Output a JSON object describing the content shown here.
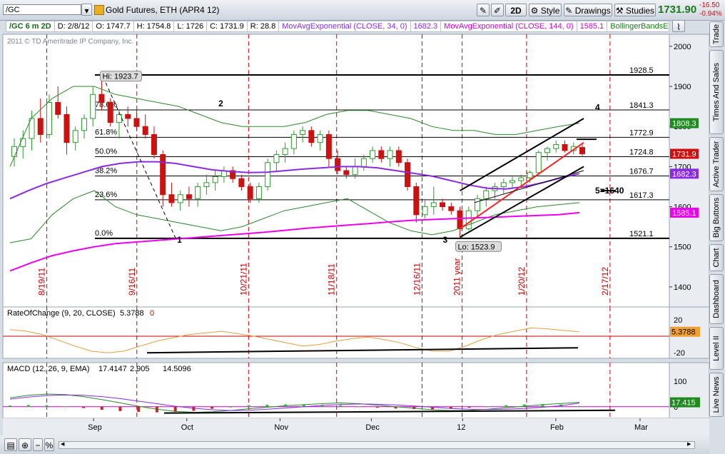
{
  "toolbar": {
    "symbol": "/GC",
    "instrument_name": "Gold Futures, ETH (APR4 12)",
    "period_button": "2D",
    "style_label": "Style",
    "drawings_label": "Drawings",
    "studies_label": "Studies",
    "last_price": "1731.90",
    "net_change": "-16.50",
    "pct_change": "-0.94%"
  },
  "infobar": {
    "symbol_period": "/GC 6 m 2D",
    "date": "D: 2/8/12",
    "open": "O: 1747.7",
    "high": "H: 1754.8",
    "low": "L: 1726",
    "close": "C: 1731.9",
    "range": "R: 28.8",
    "study1": "MovAvgExponential (CLOSE, 34, 0)",
    "study1_value": "1682.3",
    "study2": "MovAvgExponential (CLOSE, 144, 0)",
    "study2_value": "1585.1",
    "study3": "BollingerBandsEMA (..."
  },
  "copyright": "2011 © TD Ameritrade IP Company, Inc.",
  "side_tabs": [
    "Trade",
    "Times And Sales",
    "Active Trader",
    "Big Buttons",
    "Chart",
    "Dashboard",
    "Level II",
    "Live News"
  ],
  "colors": {
    "up_candle": "#2e9b2e",
    "down_candle": "#cc1111",
    "ema34": "#8a2be2",
    "ema144": "#ee00ee",
    "bollinger": "#2a8a2a",
    "vertical_markers": "#cc0000",
    "fib_lines": "#000000",
    "roc_line": "#e0a040",
    "macd_line": "#2a8a2a",
    "macd_signal": "#8a2be2"
  },
  "chart_data": [
    {
      "type": "candlestick",
      "title": "/GC 6 m 2D",
      "ylim": [
        1350,
        2030
      ],
      "yticks": [
        1400,
        1500,
        1600,
        1700,
        1800,
        1900,
        2000
      ],
      "xlabels": [
        "Sep",
        "Oct",
        "Nov",
        "Dec",
        "12",
        "Feb",
        "Mar"
      ],
      "candles": [
        {
          "o": 1725,
          "h": 1770,
          "l": 1700,
          "c": 1750
        },
        {
          "o": 1750,
          "h": 1790,
          "l": 1720,
          "c": 1770
        },
        {
          "o": 1770,
          "h": 1840,
          "l": 1740,
          "c": 1820
        },
        {
          "o": 1820,
          "h": 1870,
          "l": 1760,
          "c": 1780
        },
        {
          "o": 1780,
          "h": 1880,
          "l": 1770,
          "c": 1860
        },
        {
          "o": 1860,
          "h": 1900,
          "l": 1820,
          "c": 1830
        },
        {
          "o": 1830,
          "h": 1850,
          "l": 1730,
          "c": 1760
        },
        {
          "o": 1760,
          "h": 1800,
          "l": 1740,
          "c": 1790
        },
        {
          "o": 1790,
          "h": 1830,
          "l": 1770,
          "c": 1820
        },
        {
          "o": 1820,
          "h": 1900,
          "l": 1800,
          "c": 1880
        },
        {
          "o": 1880,
          "h": 1923.7,
          "l": 1840,
          "c": 1860
        },
        {
          "o": 1860,
          "h": 1870,
          "l": 1800,
          "c": 1810
        },
        {
          "o": 1810,
          "h": 1840,
          "l": 1770,
          "c": 1830
        },
        {
          "o": 1830,
          "h": 1850,
          "l": 1800,
          "c": 1820
        },
        {
          "o": 1820,
          "h": 1840,
          "l": 1790,
          "c": 1800
        },
        {
          "o": 1800,
          "h": 1830,
          "l": 1770,
          "c": 1780
        },
        {
          "o": 1780,
          "h": 1800,
          "l": 1720,
          "c": 1730
        },
        {
          "o": 1730,
          "h": 1740,
          "l": 1600,
          "c": 1630
        },
        {
          "o": 1630,
          "h": 1660,
          "l": 1600,
          "c": 1610
        },
        {
          "o": 1610,
          "h": 1640,
          "l": 1590,
          "c": 1630
        },
        {
          "o": 1630,
          "h": 1650,
          "l": 1600,
          "c": 1620
        },
        {
          "o": 1620,
          "h": 1660,
          "l": 1600,
          "c": 1650
        },
        {
          "o": 1650,
          "h": 1680,
          "l": 1630,
          "c": 1660
        },
        {
          "o": 1660,
          "h": 1690,
          "l": 1640,
          "c": 1675
        },
        {
          "o": 1675,
          "h": 1700,
          "l": 1660,
          "c": 1690
        },
        {
          "o": 1690,
          "h": 1700,
          "l": 1660,
          "c": 1670
        },
        {
          "o": 1670,
          "h": 1680,
          "l": 1640,
          "c": 1650
        },
        {
          "o": 1650,
          "h": 1660,
          "l": 1610,
          "c": 1620
        },
        {
          "o": 1620,
          "h": 1660,
          "l": 1610,
          "c": 1650
        },
        {
          "o": 1650,
          "h": 1720,
          "l": 1640,
          "c": 1710
        },
        {
          "o": 1710,
          "h": 1740,
          "l": 1690,
          "c": 1730
        },
        {
          "o": 1730,
          "h": 1760,
          "l": 1710,
          "c": 1745
        },
        {
          "o": 1745,
          "h": 1790,
          "l": 1730,
          "c": 1780
        },
        {
          "o": 1780,
          "h": 1800,
          "l": 1760,
          "c": 1790
        },
        {
          "o": 1790,
          "h": 1800,
          "l": 1750,
          "c": 1760
        },
        {
          "o": 1760,
          "h": 1790,
          "l": 1740,
          "c": 1780
        },
        {
          "o": 1780,
          "h": 1790,
          "l": 1700,
          "c": 1720
        },
        {
          "o": 1720,
          "h": 1740,
          "l": 1680,
          "c": 1690
        },
        {
          "o": 1690,
          "h": 1700,
          "l": 1670,
          "c": 1680
        },
        {
          "o": 1680,
          "h": 1720,
          "l": 1670,
          "c": 1700
        },
        {
          "o": 1700,
          "h": 1730,
          "l": 1690,
          "c": 1720
        },
        {
          "o": 1720,
          "h": 1750,
          "l": 1710,
          "c": 1740
        },
        {
          "o": 1740,
          "h": 1750,
          "l": 1710,
          "c": 1720
        },
        {
          "o": 1720,
          "h": 1750,
          "l": 1700,
          "c": 1740
        },
        {
          "o": 1740,
          "h": 1750,
          "l": 1700,
          "c": 1710
        },
        {
          "o": 1710,
          "h": 1720,
          "l": 1640,
          "c": 1650
        },
        {
          "o": 1650,
          "h": 1660,
          "l": 1560,
          "c": 1580
        },
        {
          "o": 1580,
          "h": 1620,
          "l": 1570,
          "c": 1600
        },
        {
          "o": 1600,
          "h": 1650,
          "l": 1580,
          "c": 1610
        },
        {
          "o": 1610,
          "h": 1620,
          "l": 1590,
          "c": 1600
        },
        {
          "o": 1600,
          "h": 1610,
          "l": 1580,
          "c": 1590
        },
        {
          "o": 1590,
          "h": 1600,
          "l": 1523.9,
          "c": 1545
        },
        {
          "o": 1545,
          "h": 1600,
          "l": 1540,
          "c": 1590
        },
        {
          "o": 1590,
          "h": 1630,
          "l": 1570,
          "c": 1620
        },
        {
          "o": 1620,
          "h": 1650,
          "l": 1600,
          "c": 1640
        },
        {
          "o": 1640,
          "h": 1660,
          "l": 1620,
          "c": 1650
        },
        {
          "o": 1650,
          "h": 1670,
          "l": 1630,
          "c": 1660
        },
        {
          "o": 1660,
          "h": 1675,
          "l": 1645,
          "c": 1665
        },
        {
          "o": 1665,
          "h": 1680,
          "l": 1650,
          "c": 1672
        },
        {
          "o": 1672,
          "h": 1690,
          "l": 1660,
          "c": 1685
        },
        {
          "o": 1685,
          "h": 1740,
          "l": 1680,
          "c": 1735
        },
        {
          "o": 1735,
          "h": 1750,
          "l": 1715,
          "c": 1745
        },
        {
          "o": 1745,
          "h": 1765,
          "l": 1735,
          "c": 1755
        },
        {
          "o": 1755,
          "h": 1765,
          "l": 1735,
          "c": 1740
        },
        {
          "o": 1740,
          "h": 1760,
          "l": 1730,
          "c": 1750
        },
        {
          "o": 1747.7,
          "h": 1754.8,
          "l": 1726,
          "c": 1731.9
        }
      ],
      "ema34": [
        1620,
        1640,
        1658,
        1672,
        1686,
        1700,
        1708,
        1712,
        1712,
        1708,
        1700,
        1692,
        1688,
        1685,
        1686,
        1690,
        1694,
        1697,
        1700,
        1700,
        1697,
        1690,
        1683,
        1676,
        1665,
        1654,
        1646,
        1644,
        1650,
        1660,
        1672,
        1682.3
      ],
      "ema144": [
        1440,
        1460,
        1478,
        1490,
        1500,
        1508,
        1512,
        1516,
        1520,
        1524,
        1528,
        1532,
        1536,
        1541,
        1546,
        1550,
        1554,
        1558,
        1562,
        1566,
        1568,
        1570,
        1572,
        1574,
        1576,
        1578,
        1580,
        1585.1
      ],
      "bb_upper": [
        1700,
        1820,
        1870,
        1900,
        1900,
        1880,
        1870,
        1860,
        1850,
        1830,
        1810,
        1800,
        1800,
        1800,
        1810,
        1830,
        1840,
        1840,
        1830,
        1820,
        1800,
        1790,
        1790,
        1780,
        1780,
        1790,
        1800,
        1808.3
      ],
      "bb_lower": [
        1510,
        1520,
        1580,
        1620,
        1640,
        1600,
        1580,
        1570,
        1560,
        1550,
        1540,
        1550,
        1570,
        1590,
        1600,
        1610,
        1620,
        1590,
        1560,
        1540,
        1530,
        1540,
        1560,
        1580,
        1590,
        1600,
        1605,
        1610
      ],
      "fib_levels": [
        {
          "pct": "0.0%",
          "value": 1521.1
        },
        {
          "pct": "23.6%",
          "value": 1617.3
        },
        {
          "pct": "38.2%",
          "value": 1676.7
        },
        {
          "pct": "50.0%",
          "value": 1724.8
        },
        {
          "pct": "61.8%",
          "value": 1772.9
        },
        {
          "pct": "78.6%",
          "value": 1841.3
        },
        {
          "pct": "",
          "value": 1928.5
        }
      ],
      "price_axis_markers": [
        {
          "label": "1808.3",
          "color": "#1f8a1f"
        },
        {
          "label": "1731.9",
          "color": "#cc1111"
        },
        {
          "label": "1682.3",
          "color": "#8a2be2"
        },
        {
          "label": "1585.1",
          "color": "#ee00ee"
        }
      ],
      "high_label": "Hi: 1923.7",
      "low_label": "Lo: 1523.9",
      "wave_labels": [
        "1",
        "2",
        "3",
        "4",
        "5=1640"
      ],
      "date_markers": [
        "8/19/11",
        "9/16/11",
        "10/21/11",
        "11/18/11",
        "12/16/11",
        "2011 year",
        "1/20/12",
        "2/17/12"
      ]
    },
    {
      "type": "line",
      "title": "RateOfChange (9, 20, CLOSE)",
      "value": "5.3788",
      "zero": "0",
      "ylim": [
        -25,
        25
      ],
      "yticks": [
        20,
        -20
      ],
      "axis_label": "5.3788",
      "values": [
        8,
        6,
        2,
        -5,
        -12,
        -18,
        -20,
        -18,
        -12,
        -6,
        -2,
        2,
        4,
        6,
        3,
        0,
        -4,
        -8,
        -12,
        -10,
        -6,
        -3,
        -1,
        -4,
        -8,
        -14,
        -18,
        -18,
        -12,
        -4,
        2,
        6,
        10,
        9,
        7,
        5.3788
      ]
    },
    {
      "type": "bar",
      "title": "MACD (12, 26, 9, EMA)",
      "values_text": [
        "17.4147",
        "2.905",
        "14.5096"
      ],
      "ylim": [
        -40,
        140
      ],
      "yticks": [
        100,
        0
      ],
      "axis_label": "17.415",
      "macd": [
        35,
        45,
        50,
        48,
        40,
        28,
        15,
        2,
        -10,
        -18,
        -22,
        -20,
        -15,
        -8,
        -2,
        4,
        8,
        12,
        15,
        12,
        6,
        0,
        -6,
        -12,
        -15,
        -14,
        -10,
        -4,
        2,
        8,
        13,
        17.4
      ],
      "signal": [
        30,
        38,
        44,
        46,
        45,
        40,
        32,
        22,
        12,
        2,
        -6,
        -12,
        -15,
        -14,
        -10,
        -5,
        0,
        5,
        9,
        11,
        10,
        7,
        3,
        -2,
        -7,
        -10,
        -11,
        -10,
        -7,
        -2,
        4,
        14.5
      ],
      "hist": [
        5,
        7,
        6,
        2,
        -5,
        -12,
        -17,
        -20,
        -22,
        -20,
        -16,
        -8,
        0,
        6,
        8,
        9,
        8,
        7,
        6,
        1,
        -4,
        -7,
        -9,
        -10,
        -8,
        -4,
        1,
        6,
        9,
        10,
        9,
        2.9
      ]
    }
  ],
  "bottombar": {
    "zoom_label": "⊕"
  }
}
